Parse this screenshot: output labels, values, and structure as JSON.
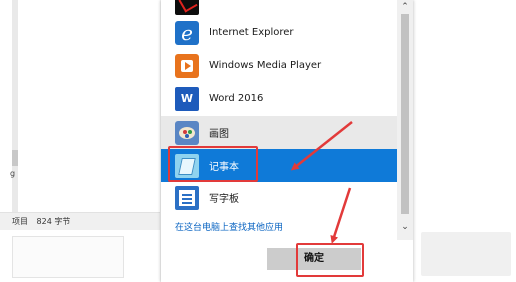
{
  "background": {
    "statusbar": {
      "items_label": "项目",
      "count": "824 字节"
    },
    "side_char": "g"
  },
  "dialog": {
    "apps": [
      {
        "name": "",
        "icon": "adobe-pdf-icon"
      },
      {
        "name": "Internet Explorer",
        "icon": "internet-explorer-icon"
      },
      {
        "name": "Windows Media Player",
        "icon": "windows-media-player-icon"
      },
      {
        "name": "Word 2016",
        "icon": "word-icon"
      },
      {
        "name": "画图",
        "icon": "paint-icon"
      },
      {
        "name": "记事本",
        "icon": "notepad-icon"
      },
      {
        "name": "写字板",
        "icon": "wordpad-icon"
      }
    ],
    "selected_index": 5,
    "more_apps_link": "在这台电脑上查找其他应用",
    "ok_button": "确定"
  },
  "scrollbar": {
    "up_arrow": "⌃",
    "down_arrow": "⌄"
  },
  "colors": {
    "selection": "#0f7ad8",
    "annotation": "#e23a3a",
    "link": "#0a64c2"
  }
}
